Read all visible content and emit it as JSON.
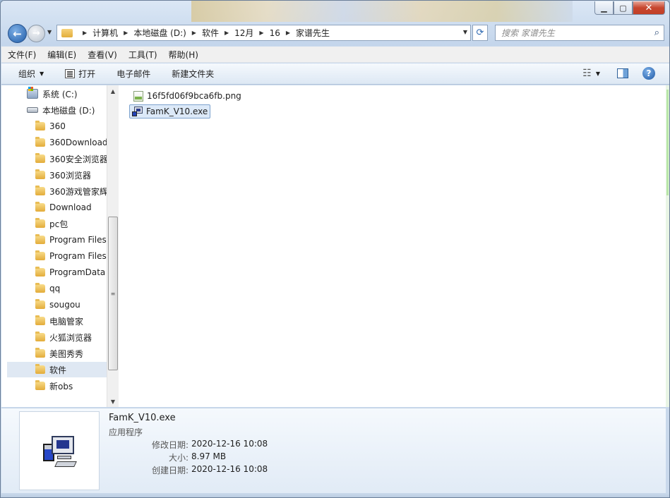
{
  "window": {
    "minimize_glyph": "▁",
    "maximize_glyph": "▢",
    "close_glyph": "✕"
  },
  "nav": {
    "back_glyph": "←",
    "forward_glyph": "→",
    "history_glyph": "▼"
  },
  "address": {
    "crumbs": [
      "计算机",
      "本地磁盘 (D:)",
      "软件",
      "12月",
      "16",
      "家谱先生"
    ],
    "sep_glyph": "▶",
    "dropdown_glyph": "▼",
    "refresh_glyph": "⟳"
  },
  "search": {
    "placeholder": "搜索 家谱先生",
    "icon_glyph": "⌕"
  },
  "menu": [
    "文件(F)",
    "编辑(E)",
    "查看(V)",
    "工具(T)",
    "帮助(H)"
  ],
  "toolbar": {
    "organize": "组织",
    "caret": "▼",
    "open": "打开",
    "email": "电子邮件",
    "new_folder": "新建文件夹",
    "views_glyph": "☷",
    "help_glyph": "?"
  },
  "tree": {
    "drives": [
      {
        "label": "系统 (C:)"
      },
      {
        "label": "本地磁盘 (D:)"
      }
    ],
    "folders": [
      "360",
      "360Download",
      "360安全浏览器",
      "360浏览器",
      "360游戏管家辉",
      "Download",
      "pc包",
      "Program Files",
      "Program Files",
      "ProgramData",
      "qq",
      "sougou",
      "电脑管家",
      "火狐浏览器",
      "美图秀秀",
      "软件",
      "新obs"
    ],
    "selected_folder": "软件",
    "scroll_up_glyph": "▲",
    "scroll_down_glyph": "▼",
    "thumb_glyph": "≡"
  },
  "files": [
    {
      "name": "16f5fd06f9bca6fb.png",
      "type": "png"
    },
    {
      "name": "FamK_V10.exe",
      "type": "exe",
      "selected": true
    }
  ],
  "details": {
    "name": "FamK_V10.exe",
    "type": "应用程序",
    "modified_label": "修改日期:",
    "modified_value": "2020-12-16 10:08",
    "size_label": "大小:",
    "size_value": "8.97 MB",
    "created_label": "创建日期:",
    "created_value": "2020-12-16 10:08"
  }
}
